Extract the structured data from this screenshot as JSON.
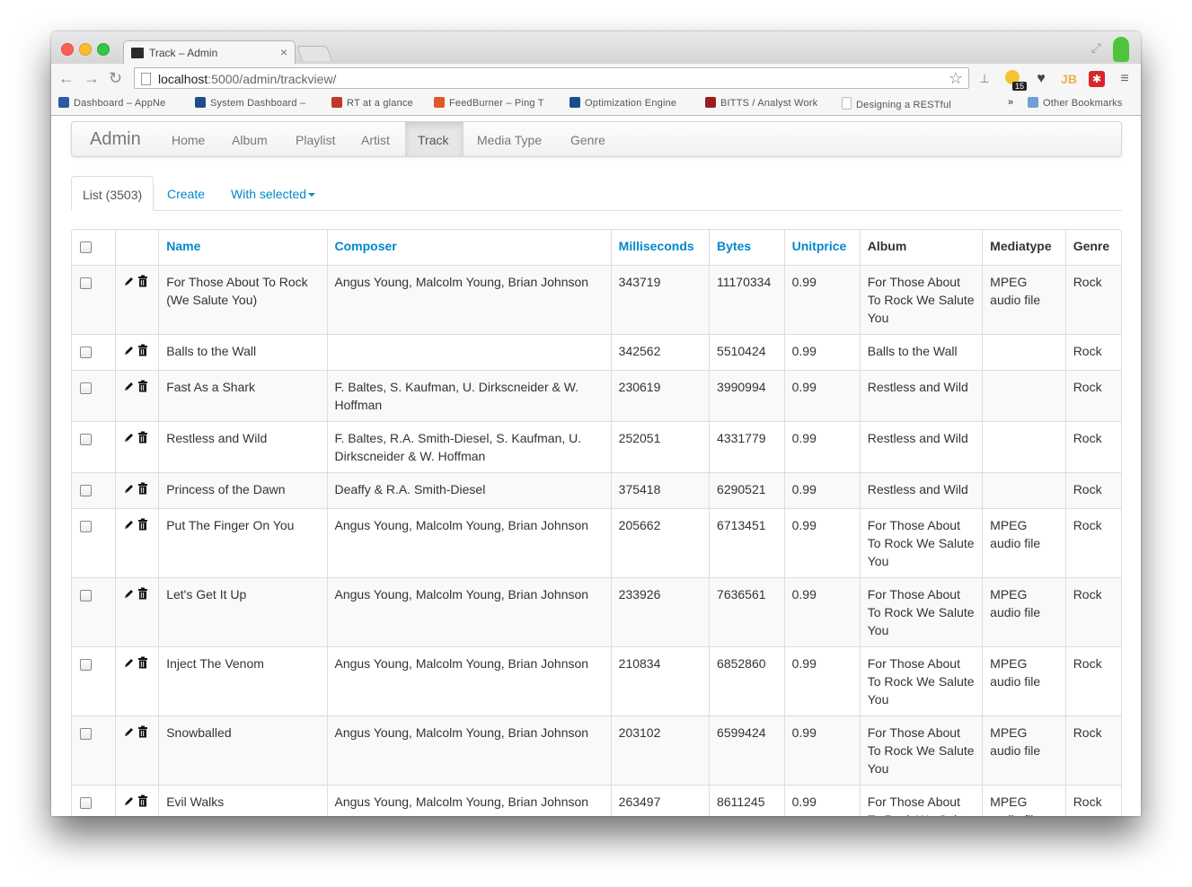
{
  "browser": {
    "tab_title": "Track – Admin",
    "tab_close": "×",
    "url_host": "localhost",
    "url_path": ":5000/admin/trackview/",
    "ext_badge": "15",
    "ext_jb": "JB",
    "bookmarks": [
      {
        "label": "Dashboard – AppNe",
        "color": "#2a5aa0"
      },
      {
        "label": "System Dashboard –",
        "color": "#1f4d8a"
      },
      {
        "label": "RT at a glance",
        "color": "#c0392b"
      },
      {
        "label": "FeedBurner – Ping T",
        "color": "#e2562a"
      },
      {
        "label": "Optimization Engine",
        "color": "#1a4d8f"
      },
      {
        "label": "BITTS / Analyst Work",
        "color": "#9b1c1c"
      },
      {
        "label": "Designing a RESTful",
        "color": "#bdbdbd"
      }
    ],
    "bookmarks_overflow": "»",
    "other_bookmarks": "Other Bookmarks"
  },
  "navbar": {
    "brand": "Admin",
    "links": [
      "Home",
      "Album",
      "Playlist",
      "Artist",
      "Track",
      "Media Type",
      "Genre"
    ],
    "active": "Track"
  },
  "tabs": {
    "list_label": "List (3503)",
    "create_label": "Create",
    "with_selected_label": "With selected"
  },
  "table": {
    "columns": [
      "Name",
      "Composer",
      "Milliseconds",
      "Bytes",
      "Unitprice",
      "Album",
      "Mediatype",
      "Genre"
    ],
    "rows": [
      [
        "For Those About To Rock (We Salute You)",
        "Angus Young, Malcolm Young, Brian Johnson",
        "343719",
        "11170334",
        "0.99",
        "For Those About To Rock We Salute You",
        "MPEG audio file",
        "Rock"
      ],
      [
        "Balls to the Wall",
        "",
        "342562",
        "5510424",
        "0.99",
        "Balls to the Wall",
        "",
        "Rock"
      ],
      [
        "Fast As a Shark",
        "F. Baltes, S. Kaufman, U. Dirkscneider & W. Hoffman",
        "230619",
        "3990994",
        "0.99",
        "Restless and Wild",
        "",
        "Rock"
      ],
      [
        "Restless and Wild",
        "F. Baltes, R.A. Smith-Diesel, S. Kaufman, U. Dirkscneider & W. Hoffman",
        "252051",
        "4331779",
        "0.99",
        "Restless and Wild",
        "",
        "Rock"
      ],
      [
        "Princess of the Dawn",
        "Deaffy & R.A. Smith-Diesel",
        "375418",
        "6290521",
        "0.99",
        "Restless and Wild",
        "",
        "Rock"
      ],
      [
        "Put The Finger On You",
        "Angus Young, Malcolm Young, Brian Johnson",
        "205662",
        "6713451",
        "0.99",
        "For Those About To Rock We Salute You",
        "MPEG audio file",
        "Rock"
      ],
      [
        "Let's Get It Up",
        "Angus Young, Malcolm Young, Brian Johnson",
        "233926",
        "7636561",
        "0.99",
        "For Those About To Rock We Salute You",
        "MPEG audio file",
        "Rock"
      ],
      [
        "Inject The Venom",
        "Angus Young, Malcolm Young, Brian Johnson",
        "210834",
        "6852860",
        "0.99",
        "For Those About To Rock We Salute You",
        "MPEG audio file",
        "Rock"
      ],
      [
        "Snowballed",
        "Angus Young, Malcolm Young, Brian Johnson",
        "203102",
        "6599424",
        "0.99",
        "For Those About To Rock We Salute You",
        "MPEG audio file",
        "Rock"
      ],
      [
        "Evil Walks",
        "Angus Young, Malcolm Young, Brian Johnson",
        "263497",
        "8611245",
        "0.99",
        "For Those About To Rock We Salute You",
        "MPEG audio file",
        "Rock"
      ]
    ]
  },
  "colors": {
    "link": "#0088cc",
    "text": "#333333",
    "border": "#dddddd"
  }
}
